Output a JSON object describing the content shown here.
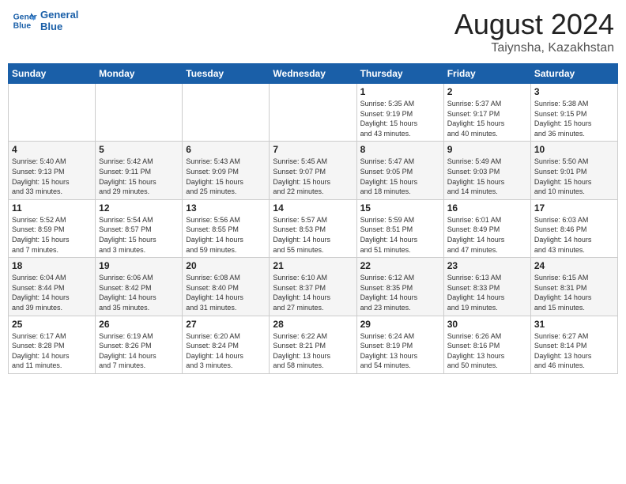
{
  "header": {
    "logo_line1": "General",
    "logo_line2": "Blue",
    "month": "August 2024",
    "location": "Taiynsha, Kazakhstan"
  },
  "weekdays": [
    "Sunday",
    "Monday",
    "Tuesday",
    "Wednesday",
    "Thursday",
    "Friday",
    "Saturday"
  ],
  "weeks": [
    [
      {
        "day": "",
        "info": ""
      },
      {
        "day": "",
        "info": ""
      },
      {
        "day": "",
        "info": ""
      },
      {
        "day": "",
        "info": ""
      },
      {
        "day": "1",
        "info": "Sunrise: 5:35 AM\nSunset: 9:19 PM\nDaylight: 15 hours\nand 43 minutes."
      },
      {
        "day": "2",
        "info": "Sunrise: 5:37 AM\nSunset: 9:17 PM\nDaylight: 15 hours\nand 40 minutes."
      },
      {
        "day": "3",
        "info": "Sunrise: 5:38 AM\nSunset: 9:15 PM\nDaylight: 15 hours\nand 36 minutes."
      }
    ],
    [
      {
        "day": "4",
        "info": "Sunrise: 5:40 AM\nSunset: 9:13 PM\nDaylight: 15 hours\nand 33 minutes."
      },
      {
        "day": "5",
        "info": "Sunrise: 5:42 AM\nSunset: 9:11 PM\nDaylight: 15 hours\nand 29 minutes."
      },
      {
        "day": "6",
        "info": "Sunrise: 5:43 AM\nSunset: 9:09 PM\nDaylight: 15 hours\nand 25 minutes."
      },
      {
        "day": "7",
        "info": "Sunrise: 5:45 AM\nSunset: 9:07 PM\nDaylight: 15 hours\nand 22 minutes."
      },
      {
        "day": "8",
        "info": "Sunrise: 5:47 AM\nSunset: 9:05 PM\nDaylight: 15 hours\nand 18 minutes."
      },
      {
        "day": "9",
        "info": "Sunrise: 5:49 AM\nSunset: 9:03 PM\nDaylight: 15 hours\nand 14 minutes."
      },
      {
        "day": "10",
        "info": "Sunrise: 5:50 AM\nSunset: 9:01 PM\nDaylight: 15 hours\nand 10 minutes."
      }
    ],
    [
      {
        "day": "11",
        "info": "Sunrise: 5:52 AM\nSunset: 8:59 PM\nDaylight: 15 hours\nand 7 minutes."
      },
      {
        "day": "12",
        "info": "Sunrise: 5:54 AM\nSunset: 8:57 PM\nDaylight: 15 hours\nand 3 minutes."
      },
      {
        "day": "13",
        "info": "Sunrise: 5:56 AM\nSunset: 8:55 PM\nDaylight: 14 hours\nand 59 minutes."
      },
      {
        "day": "14",
        "info": "Sunrise: 5:57 AM\nSunset: 8:53 PM\nDaylight: 14 hours\nand 55 minutes."
      },
      {
        "day": "15",
        "info": "Sunrise: 5:59 AM\nSunset: 8:51 PM\nDaylight: 14 hours\nand 51 minutes."
      },
      {
        "day": "16",
        "info": "Sunrise: 6:01 AM\nSunset: 8:49 PM\nDaylight: 14 hours\nand 47 minutes."
      },
      {
        "day": "17",
        "info": "Sunrise: 6:03 AM\nSunset: 8:46 PM\nDaylight: 14 hours\nand 43 minutes."
      }
    ],
    [
      {
        "day": "18",
        "info": "Sunrise: 6:04 AM\nSunset: 8:44 PM\nDaylight: 14 hours\nand 39 minutes."
      },
      {
        "day": "19",
        "info": "Sunrise: 6:06 AM\nSunset: 8:42 PM\nDaylight: 14 hours\nand 35 minutes."
      },
      {
        "day": "20",
        "info": "Sunrise: 6:08 AM\nSunset: 8:40 PM\nDaylight: 14 hours\nand 31 minutes."
      },
      {
        "day": "21",
        "info": "Sunrise: 6:10 AM\nSunset: 8:37 PM\nDaylight: 14 hours\nand 27 minutes."
      },
      {
        "day": "22",
        "info": "Sunrise: 6:12 AM\nSunset: 8:35 PM\nDaylight: 14 hours\nand 23 minutes."
      },
      {
        "day": "23",
        "info": "Sunrise: 6:13 AM\nSunset: 8:33 PM\nDaylight: 14 hours\nand 19 minutes."
      },
      {
        "day": "24",
        "info": "Sunrise: 6:15 AM\nSunset: 8:31 PM\nDaylight: 14 hours\nand 15 minutes."
      }
    ],
    [
      {
        "day": "25",
        "info": "Sunrise: 6:17 AM\nSunset: 8:28 PM\nDaylight: 14 hours\nand 11 minutes."
      },
      {
        "day": "26",
        "info": "Sunrise: 6:19 AM\nSunset: 8:26 PM\nDaylight: 14 hours\nand 7 minutes."
      },
      {
        "day": "27",
        "info": "Sunrise: 6:20 AM\nSunset: 8:24 PM\nDaylight: 14 hours\nand 3 minutes."
      },
      {
        "day": "28",
        "info": "Sunrise: 6:22 AM\nSunset: 8:21 PM\nDaylight: 13 hours\nand 58 minutes."
      },
      {
        "day": "29",
        "info": "Sunrise: 6:24 AM\nSunset: 8:19 PM\nDaylight: 13 hours\nand 54 minutes."
      },
      {
        "day": "30",
        "info": "Sunrise: 6:26 AM\nSunset: 8:16 PM\nDaylight: 13 hours\nand 50 minutes."
      },
      {
        "day": "31",
        "info": "Sunrise: 6:27 AM\nSunset: 8:14 PM\nDaylight: 13 hours\nand 46 minutes."
      }
    ]
  ]
}
